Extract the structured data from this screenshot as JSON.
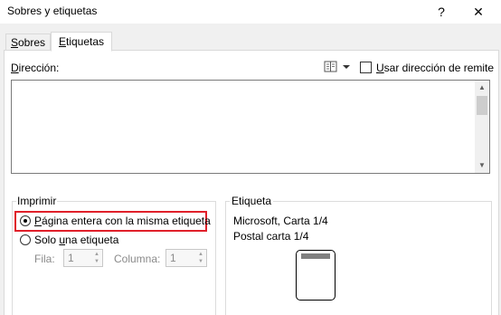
{
  "window": {
    "title": "Sobres y etiquetas",
    "help": "?",
    "close": "✕"
  },
  "tabs": [
    {
      "label": "Sobres",
      "mnemonic": "S",
      "rest": "obres",
      "active": false
    },
    {
      "label": "Etiquetas",
      "mnemonic": "E",
      "rest": "tiquetas",
      "active": true
    }
  ],
  "address": {
    "label": "Dirección:",
    "label_mnemonic": "D",
    "label_rest": "irección:",
    "value": "",
    "book_icon": "address-book-icon",
    "use_return": {
      "label": "Usar dirección de remite",
      "mnemonic": "U",
      "rest": "sar dirección de remite",
      "checked": false
    }
  },
  "print_group": {
    "title": "Imprimir",
    "options": [
      {
        "label": "Página entera con la misma etiqueta",
        "mnemonic": "P",
        "rest": "ágina entera con la misma etiqueta",
        "selected": true
      },
      {
        "label": "Solo una etiqueta",
        "pre": "Solo ",
        "mnemonic": "u",
        "rest": "na etiqueta",
        "selected": false
      }
    ],
    "row": {
      "label": "Fila:",
      "value": "1"
    },
    "column": {
      "label": "Columna:",
      "value": "1"
    }
  },
  "label_group": {
    "title": "Etiqueta",
    "vendor": "Microsoft, Carta 1/4",
    "product": "Postal carta 1/4"
  },
  "colors": {
    "highlight": "#e0202a",
    "panel": "#ffffff",
    "background": "#f0f0f0"
  }
}
